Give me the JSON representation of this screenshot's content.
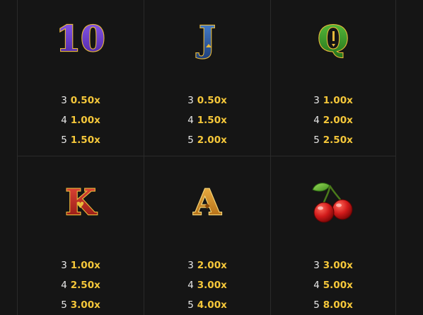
{
  "paytable": {
    "symbols": [
      {
        "icon": "ten-symbol-icon",
        "glyph": "10",
        "color": "#6b3fc9",
        "pays": [
          {
            "count": "3",
            "mult": "0.50x"
          },
          {
            "count": "4",
            "mult": "1.00x"
          },
          {
            "count": "5",
            "mult": "1.50x"
          }
        ]
      },
      {
        "icon": "jack-symbol-icon",
        "glyph": "J",
        "color": "#2d5fa8",
        "pays": [
          {
            "count": "3",
            "mult": "0.50x"
          },
          {
            "count": "4",
            "mult": "1.50x"
          },
          {
            "count": "5",
            "mult": "2.00x"
          }
        ]
      },
      {
        "icon": "queen-symbol-icon",
        "glyph": "Q",
        "color": "#3c9a2a",
        "pays": [
          {
            "count": "3",
            "mult": "1.00x"
          },
          {
            "count": "4",
            "mult": "2.00x"
          },
          {
            "count": "5",
            "mult": "2.50x"
          }
        ]
      },
      {
        "icon": "king-symbol-icon",
        "glyph": "K",
        "color": "#c02a20",
        "pays": [
          {
            "count": "3",
            "mult": "1.00x"
          },
          {
            "count": "4",
            "mult": "2.50x"
          },
          {
            "count": "5",
            "mult": "3.00x"
          }
        ]
      },
      {
        "icon": "ace-symbol-icon",
        "glyph": "A",
        "color": "#d9901e",
        "pays": [
          {
            "count": "3",
            "mult": "2.00x"
          },
          {
            "count": "4",
            "mult": "3.00x"
          },
          {
            "count": "5",
            "mult": "4.00x"
          }
        ]
      },
      {
        "icon": "cherry-symbol-icon",
        "color": "#d11a1a",
        "pays": [
          {
            "count": "3",
            "mult": "3.00x"
          },
          {
            "count": "4",
            "mult": "5.00x"
          },
          {
            "count": "5",
            "mult": "8.00x"
          }
        ]
      }
    ],
    "colors": {
      "background": "#151515",
      "multiplier": "#f5c73a",
      "count": "#e8e8e8",
      "outline": "#e8b93a"
    }
  }
}
